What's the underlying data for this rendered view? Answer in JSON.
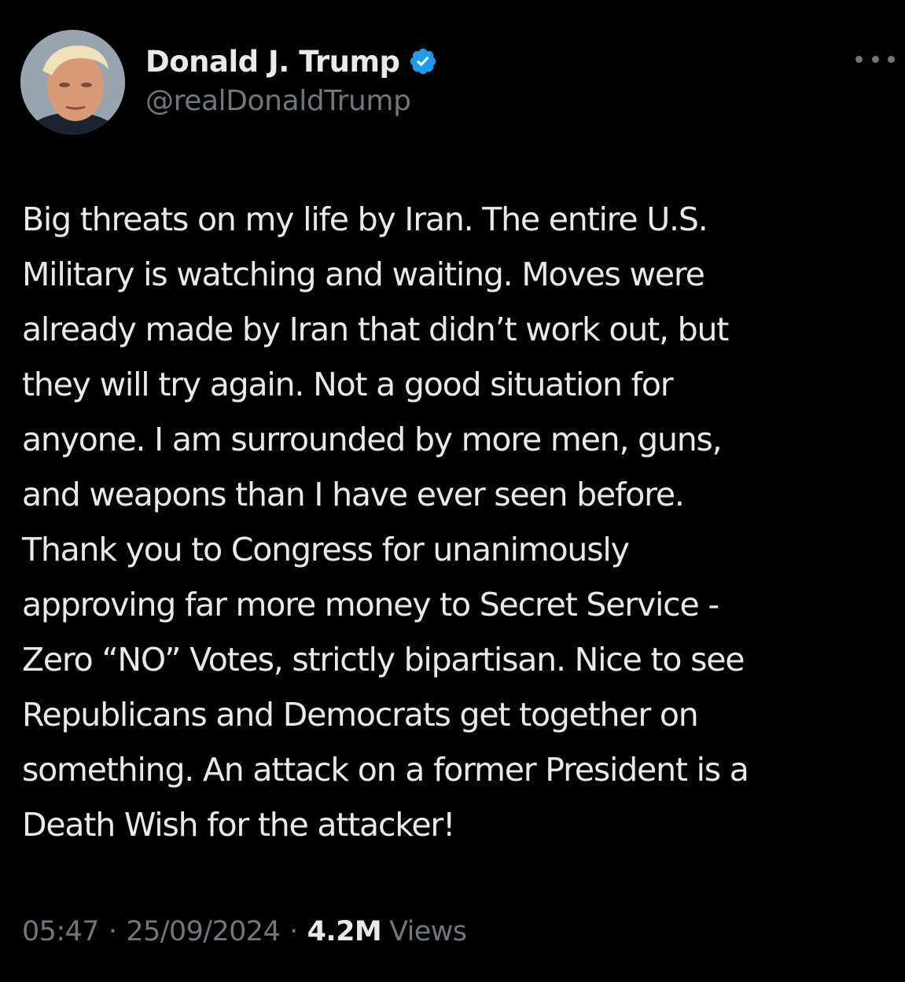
{
  "author": {
    "display_name": "Donald J. Trump",
    "handle": "@realDonaldTrump",
    "verified": true,
    "verified_color": "#1d9bf0"
  },
  "tweet": {
    "lines": [
      "Big threats on my life by Iran. The entire U.S.",
      "Military is watching and waiting. Moves were",
      "already made by Iran that didn’t work out, but",
      "they will try again. Not a good situation for",
      "anyone. I am surrounded by more men, guns,",
      "and weapons than I have ever seen before.",
      "Thank you to Congress for unanimously",
      "approving far more money to Secret Service -",
      "Zero “NO” Votes, strictly bipartisan. Nice to see",
      "Republicans and Democrats get together on",
      "something. An attack on a former President is a",
      "Death Wish for the attacker!"
    ]
  },
  "meta": {
    "time": "05:47",
    "separator": "·",
    "date": "25/09/2024",
    "views_count": "4.2M",
    "views_label": "Views"
  },
  "icons": {
    "more": "more-horizontal-icon",
    "verified": "verified-badge-icon"
  },
  "colors": {
    "background": "#000000",
    "primary_text": "#e7e9ea",
    "secondary_text": "#71767b"
  }
}
